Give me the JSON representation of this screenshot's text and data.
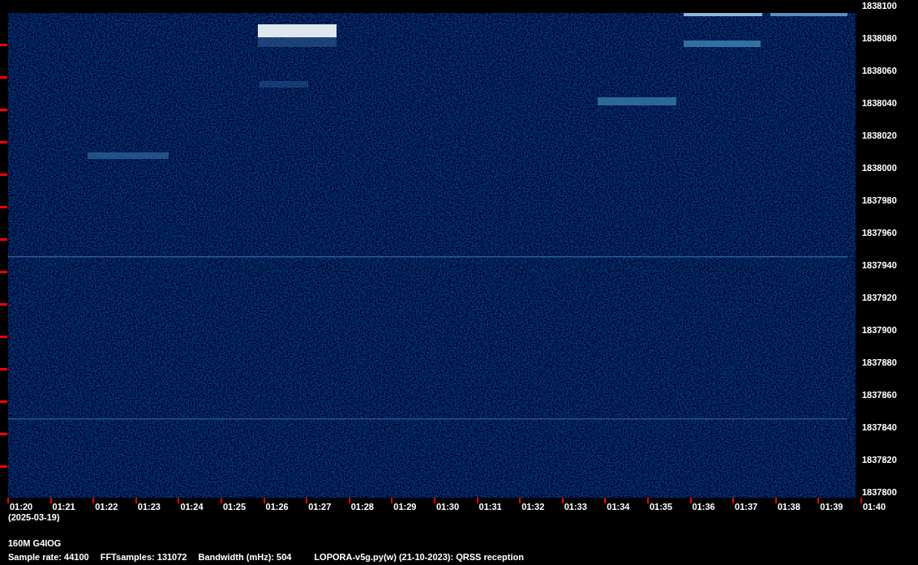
{
  "plot": {
    "frequency_labels": [
      "1838100",
      "1838080",
      "1838060",
      "1838040",
      "1838020",
      "1838000",
      "1837980",
      "1837960",
      "1837940",
      "1837920",
      "1837900",
      "1837880",
      "1837860",
      "1837840",
      "1837820",
      "1837800"
    ],
    "time_labels": [
      "01:20",
      "01:21",
      "01:22",
      "01:23",
      "01:24",
      "01:25",
      "01:26",
      "01:27",
      "01:28",
      "01:29",
      "01:30",
      "01:31",
      "01:32",
      "01:33",
      "01:34",
      "01:35",
      "01:36",
      "01:37",
      "01:38",
      "01:39",
      "01:40"
    ],
    "date": "(2025-03-19)"
  },
  "footer": {
    "station": "160M G4IOG",
    "info": [
      "Sample rate: 44100",
      "FFTsamples: 131072",
      "Bandwidth (mHz): 504",
      "LOPORA-v5g.py(w) (21-10-2023): QRSS reception"
    ]
  }
}
